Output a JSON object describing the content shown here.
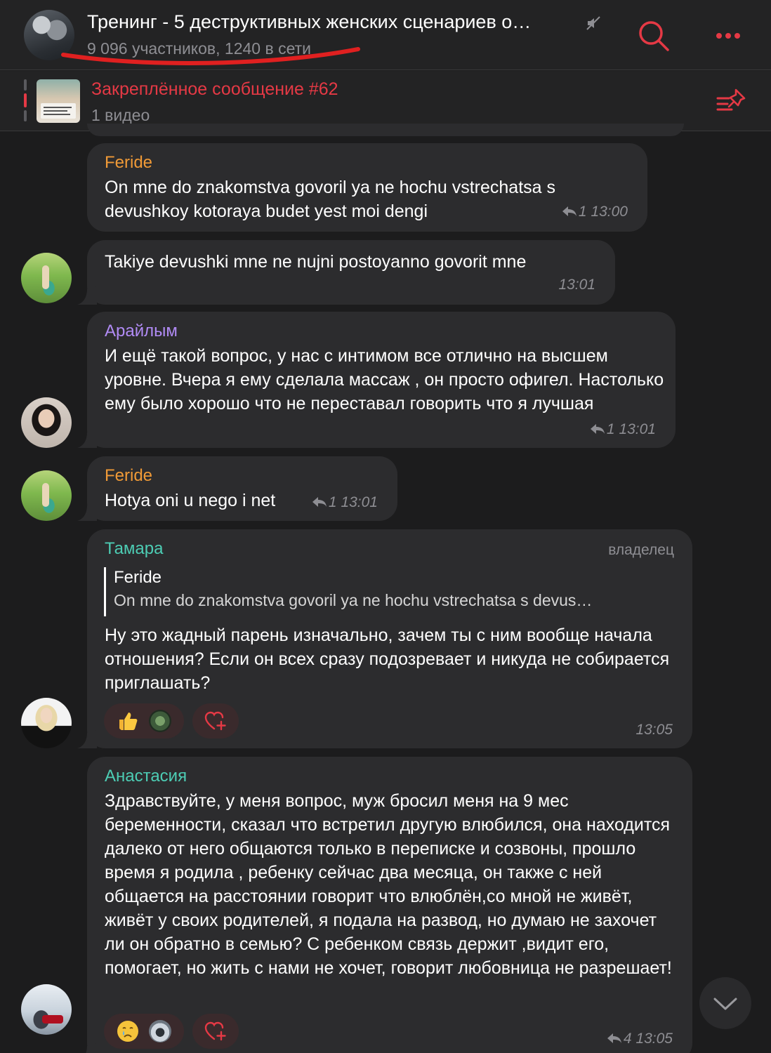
{
  "header": {
    "title": "Тренинг - 5 деструктивных женских сценариев о…",
    "subtitle": "9 096 участников, 1240 в сети",
    "muted_icon": "muted-speaker-icon",
    "search_icon": "search-icon",
    "more_icon": "more-dots-icon"
  },
  "pinned": {
    "title": "Закреплённое сообщение #62",
    "subtitle": "1 видео",
    "icon": "pinned-list-icon"
  },
  "colors": {
    "accent": "#e53945",
    "background": "#1c1c1d",
    "bubble": "#2c2c2e",
    "name_orange": "#f09a37",
    "name_purple": "#b18bf5",
    "name_teal": "#4dcdb4"
  },
  "messages": [
    {
      "sender": "Feride",
      "text": "On mne do znakomstva govoril ya ne hochu vstrechatsa s devushkoy kotoraya budet yest moi dengi",
      "replies": "1",
      "time": "13:00"
    },
    {
      "sender": "",
      "text": "Takiye devushki mne ne nujni postoyanno govorit mne",
      "time": "13:01"
    },
    {
      "sender": "Арайлым",
      "text": "И ещё такой вопрос, у нас с интимом все отлично на высшем уровне. Вчера я ему сделала массаж , он просто офигел. Настолько ему было хорошо что не переставал говорить что я лучшая",
      "replies": "1",
      "time": "13:01"
    },
    {
      "sender": "Feride",
      "text": "Hotya oni u nego i net",
      "replies": "1",
      "time": "13:01"
    },
    {
      "sender": "Тамара",
      "role": "владелец",
      "quote_name": "Feride",
      "quote_text": "On mne do znakomstva govoril ya ne hochu vstrechatsa s devus…",
      "text": "Ну это жадный парень изначально, зачем ты с ним вообще начала отношения? Если он всех сразу подозревает и никуда не собирается приглашать?",
      "reactions": [
        "thumbs-up",
        "reactor-avatar"
      ],
      "time": "13:05"
    },
    {
      "sender": "Анастасия",
      "text": "Здравствуйте, у меня вопрос, муж бросил меня на 9 мес беременности, сказал что встретил другую влюбился, она находится далеко от него общаются только в переписке и созвоны, прошло время я родила , ребенку сейчас два месяца, он также с ней общается на расстоянии говорит что влюблён,со мной не живёт, живёт у своих родителей, я подала на развод, но думаю не захочет ли он обратно в семью? С ребенком связь держит ,видит его, помогает, но жить с нами не хочет, говорит любовница не разрешает!",
      "reactions": [
        "crying-face",
        "reactor-avatar"
      ],
      "replies": "4",
      "time": "13:05"
    }
  ]
}
